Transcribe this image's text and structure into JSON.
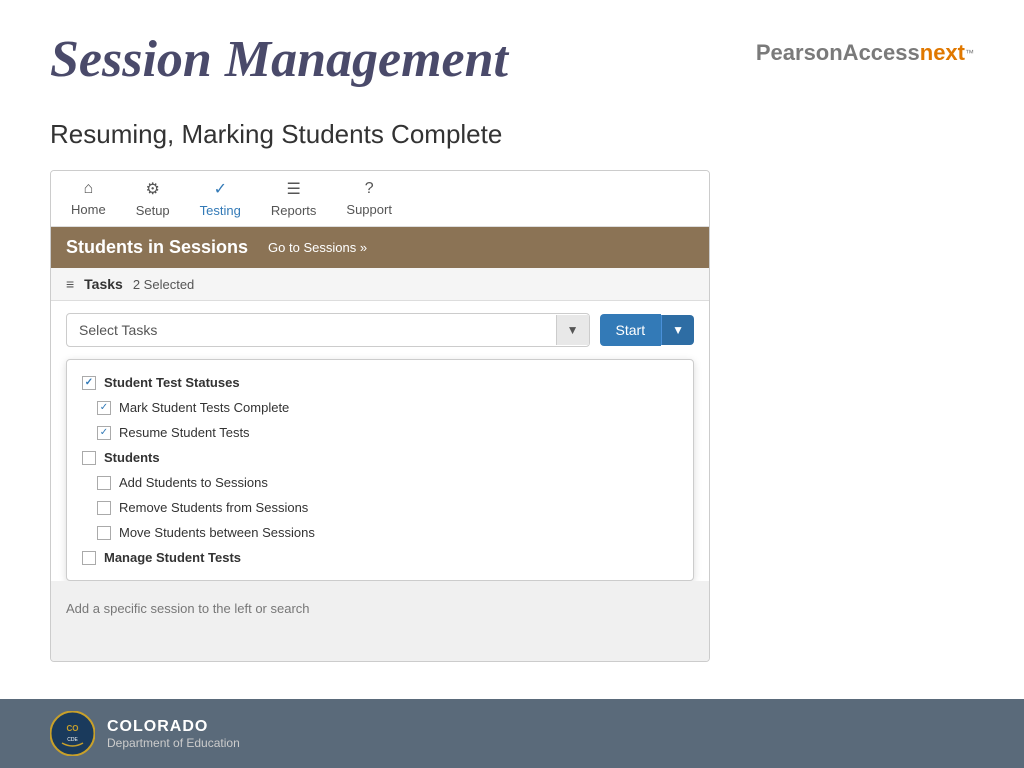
{
  "header": {
    "title": "Session Management",
    "logo": {
      "pearson": "PearsonAccess",
      "next": "next",
      "tm": "™"
    }
  },
  "subtitle": "Resuming, Marking Students Complete",
  "nav": {
    "items": [
      {
        "label": "Home",
        "icon": "⌂",
        "active": false
      },
      {
        "label": "Setup",
        "icon": "⚙",
        "active": false
      },
      {
        "label": "Testing",
        "icon": "✓",
        "active": true
      },
      {
        "label": "Reports",
        "icon": "☰",
        "active": false
      },
      {
        "label": "Support",
        "icon": "?",
        "active": false
      }
    ]
  },
  "page_header": {
    "title": "Students in Sessions",
    "goto_sessions": "Go to Sessions »"
  },
  "tasks_bar": {
    "icon": "≡",
    "label": "Tasks",
    "count": "2 Selected"
  },
  "select_tasks": {
    "placeholder": "Select Tasks",
    "caret": "▼",
    "start_label": "Start",
    "start_caret": "▼"
  },
  "dropdown": {
    "groups": [
      {
        "label": "Student Test Statuses",
        "checked": true,
        "children": [
          {
            "label": "Mark Student Tests Complete",
            "checked": true
          },
          {
            "label": "Resume Student Tests",
            "checked": true
          }
        ]
      },
      {
        "label": "Students",
        "checked": false,
        "children": [
          {
            "label": "Add Students to Sessions",
            "checked": false
          },
          {
            "label": "Remove Students from Sessions",
            "checked": false
          },
          {
            "label": "Move Students between Sessions",
            "checked": false
          }
        ]
      },
      {
        "label": "Manage Student Tests",
        "checked": false,
        "children": []
      }
    ]
  },
  "session_hint": "Add a specific session to the left or search",
  "footer": {
    "state": "COLORADO",
    "department": "Department of Education"
  }
}
